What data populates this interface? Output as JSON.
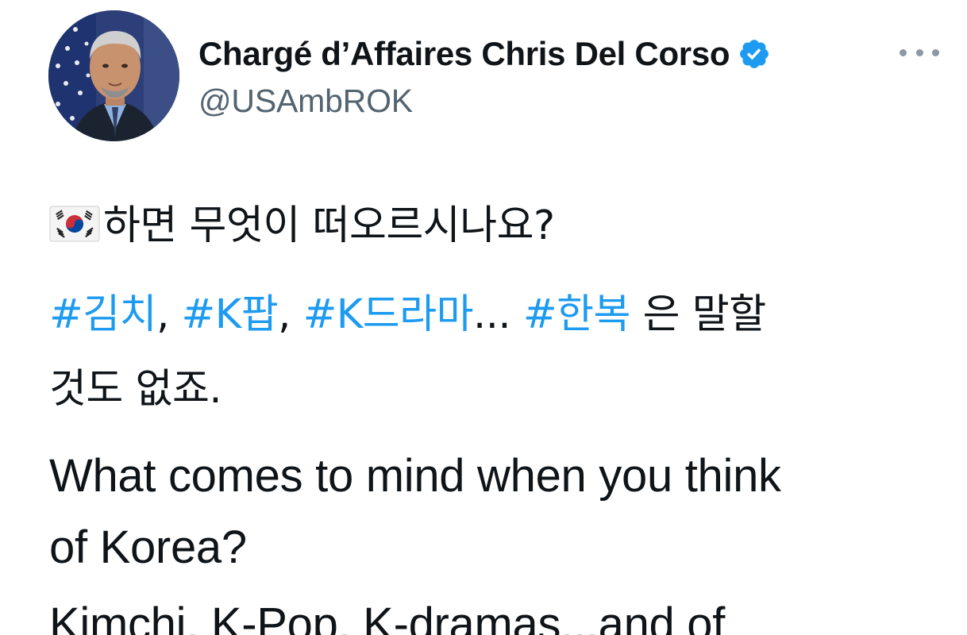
{
  "author": {
    "display_name": "Chargé d’Affaires Chris Del Corso",
    "handle": "@USAmbROK",
    "verified": true,
    "verified_color": "#1d9bf0"
  },
  "icons": {
    "verified": "verified-badge-icon",
    "more": "more-horizontal-icon",
    "flag": "south-korea-flag-icon"
  },
  "colors": {
    "hashtag": "#1d9bf0",
    "text": "#0f1419",
    "secondary": "#536471"
  },
  "tweet": {
    "korean_question": "하면 무엇이 떠오르시나요?",
    "hashtags": [
      "#김치",
      "#K팝",
      "#K드라마",
      "#한복"
    ],
    "sep1": ", ",
    "sep2": ", ",
    "sep3": "... ",
    "ko_tail_1": " 은 말할",
    "ko_tail_2": "것도 없죠.",
    "en_line_1": "What comes to mind when you think",
    "en_line_2": "of Korea?",
    "en_line_3": "Kimchi, K-Pop, K-dramas...and of"
  }
}
